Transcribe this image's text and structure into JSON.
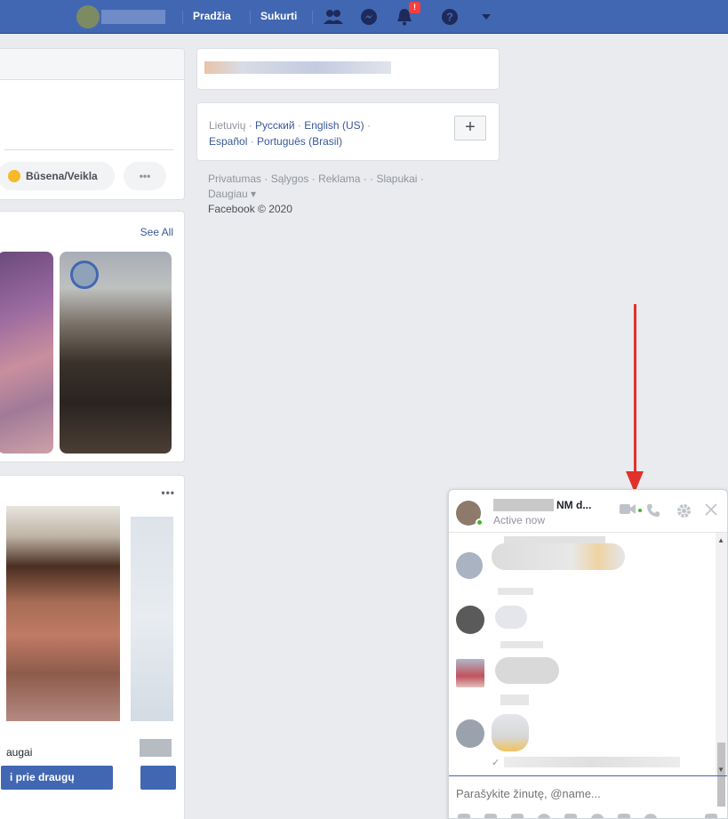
{
  "topbar": {
    "home": "Pradžia",
    "create": "Sukurti",
    "notification_count": "!"
  },
  "composer": {
    "status_activity": "Būsena/Veikla",
    "more": "•••"
  },
  "stories": {
    "see_all": "See All"
  },
  "pymk": {
    "more": "•••",
    "mutual_suffix": "augai",
    "add_label": "i prie draugų"
  },
  "languages": {
    "current": "Lietuvių",
    "others": [
      "Русский",
      "English (US)",
      "Español",
      "Português (Brasil)"
    ],
    "add": "+"
  },
  "footer": {
    "links": [
      "Privatumas",
      "Sąlygos",
      "Reklama",
      "Slapukai",
      "Daugiau"
    ],
    "copyright": "Facebook © 2020"
  },
  "chat": {
    "name_visible": "NM d...",
    "status": "Active now",
    "input_placeholder": "Parašykite žinutę, @name..."
  },
  "colors": {
    "topbar": "#4267b2",
    "link": "#385898",
    "online": "#42b72a",
    "arrow": "#e0322b",
    "background": "#e9ebee"
  }
}
